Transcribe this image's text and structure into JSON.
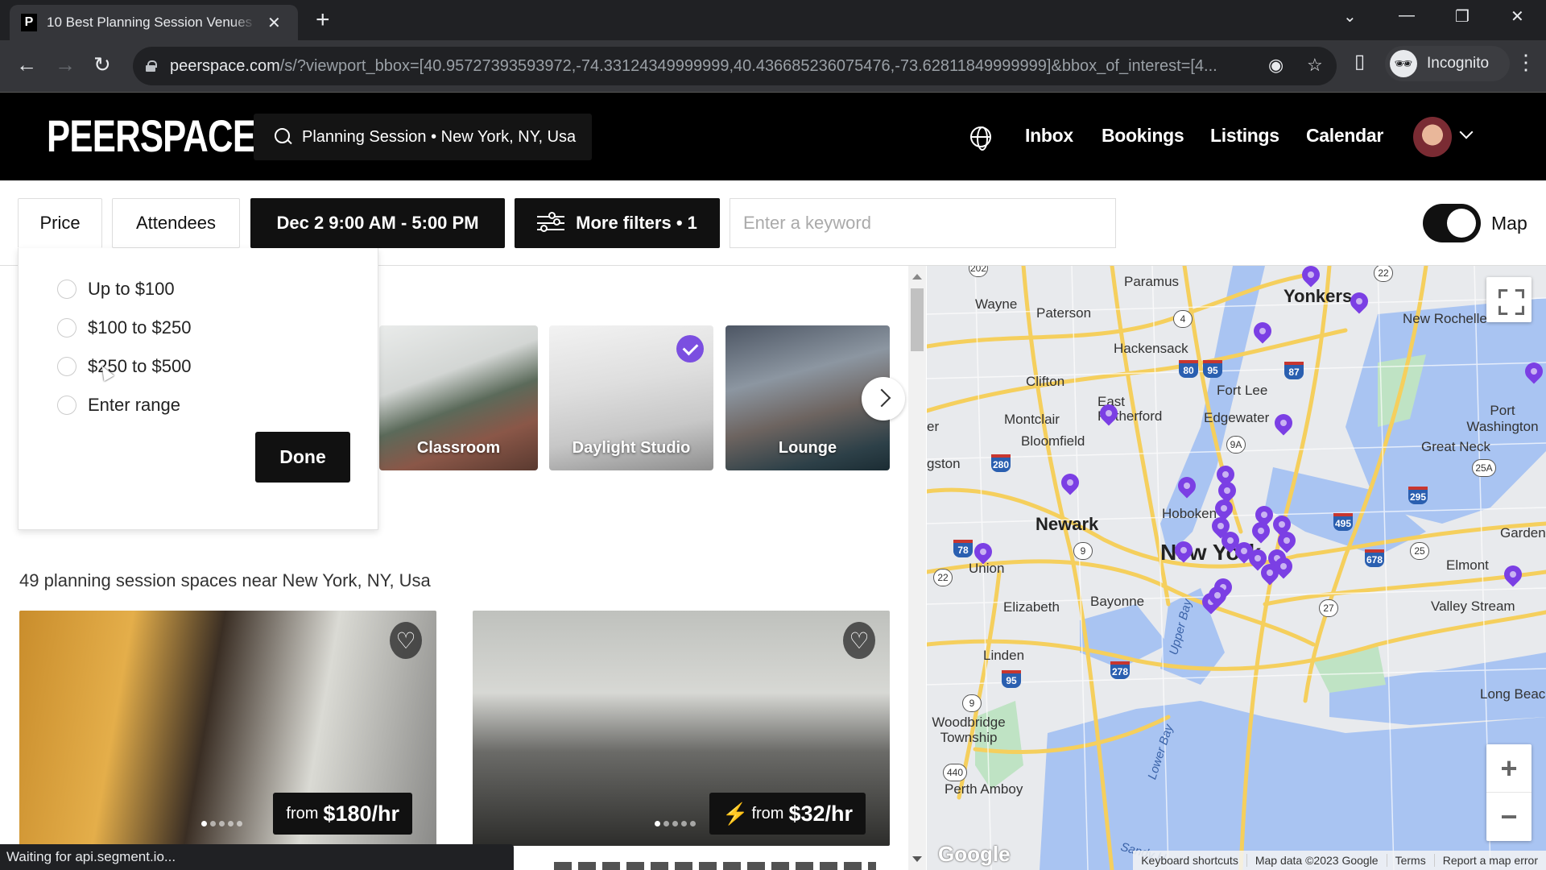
{
  "browser": {
    "tab_title": "10 Best Planning Session Venues",
    "favicon_letter": "P",
    "url_host": "peerspace.com",
    "url_path": "/s/?viewport_bbox=[40.95727393593972,-74.33124349999999,40.436685236075476,-73.62811849999999]&bbox_of_interest=[4...",
    "profile_label": "Incognito",
    "status_text": "Waiting for api.segment.io..."
  },
  "header": {
    "logo": "PEERSPACE",
    "search_text": "Planning Session • New York, NY, Usa",
    "nav": [
      "Inbox",
      "Bookings",
      "Listings",
      "Calendar"
    ]
  },
  "filters": {
    "price_label": "Price",
    "attendees_label": "Attendees",
    "date_label": "Dec 2 9:00 AM - 5:00 PM",
    "more_filters_label": "More filters • 1",
    "keyword_placeholder": "Enter a keyword",
    "keyword_value": "",
    "map_toggle_label": "Map",
    "map_toggle_on": true
  },
  "price_dropdown": {
    "options": [
      {
        "label": "Up to $100",
        "selected": false
      },
      {
        "label": "$100 to $250",
        "selected": false
      },
      {
        "label": "$250 to $500",
        "selected": false
      },
      {
        "label": "Enter range",
        "selected": false
      }
    ],
    "done_label": "Done"
  },
  "categories": [
    {
      "label": "Classroom",
      "selected": false
    },
    {
      "label": "Daylight Studio",
      "selected": true
    },
    {
      "label": "Lounge",
      "selected": false
    }
  ],
  "results": {
    "count_text": "49 planning session spaces near New York, NY, Usa",
    "listings": [
      {
        "price_prefix": "from",
        "price": "$180/hr",
        "instant_book": false,
        "photo_count": 5,
        "photo_index": 1
      },
      {
        "price_prefix": "from",
        "price": "$32/hr",
        "instant_book": true,
        "photo_count": 5,
        "photo_index": 1
      }
    ]
  },
  "map": {
    "labels": {
      "wayne": "Wayne",
      "paramus": "Paramus",
      "paterson": "Paterson",
      "hackensack": "Hackensack",
      "yonkers": "Yonkers",
      "new_rochelle": "New Rochelle",
      "clifton": "Clifton",
      "fort_lee": "Fort Lee",
      "east_rutherford": "East Rutherford",
      "montclair": "Montclair",
      "edgewater": "Edgewater",
      "bloomfield": "Bloomfield",
      "port_washington": "Port Washington",
      "great_neck": "Great Neck",
      "livingston": "gston",
      "newark": "Newark",
      "hoboken": "Hoboken",
      "new_york": "New York",
      "garden": "Garden",
      "union": "Union",
      "elmont": "Elmont",
      "elizabeth": "Elizabeth",
      "bayonne": "Bayonne",
      "valley_stream": "Valley Stream",
      "linden": "Linden",
      "long_beach": "Long Beac",
      "woodbridge": "Woodbridge Township",
      "perth_amboy": "Perth Amboy",
      "upper_bay": "Upper Bay",
      "lower_bay": "Lower Bay",
      "sandy_hook": "Sandy H",
      "verona": "er"
    },
    "shields": [
      "202",
      "4",
      "22",
      "80",
      "95",
      "87",
      "280",
      "9A",
      "25A",
      "295",
      "495",
      "78",
      "9",
      "22",
      "678",
      "25",
      "27",
      "278",
      "95",
      "9",
      "440"
    ],
    "footer": [
      "Keyboard shortcuts",
      "Map data ©2023 Google",
      "Terms",
      "Report a map error"
    ],
    "google_logo": "Google",
    "pin_color": "#7b3fe4"
  },
  "colors": {
    "accent": "#7b4fe0",
    "header_bg": "#000000",
    "button_dark": "#111111"
  }
}
